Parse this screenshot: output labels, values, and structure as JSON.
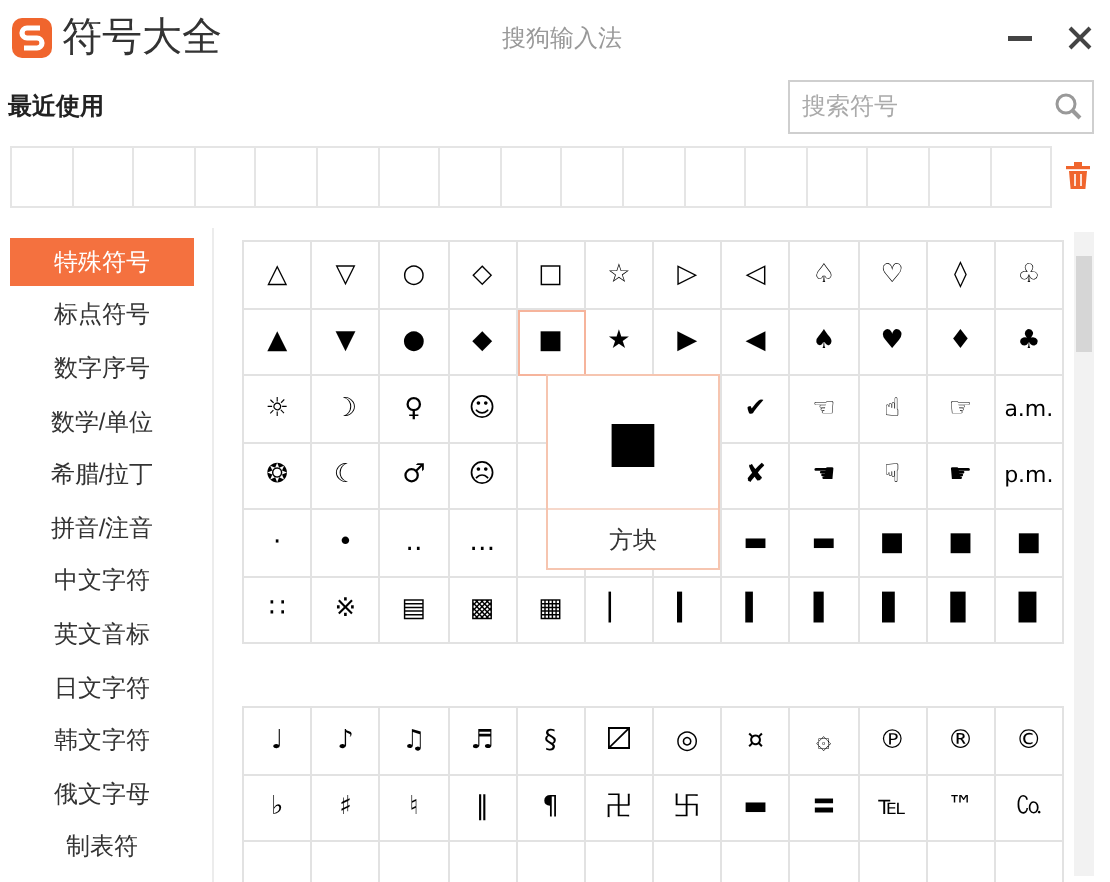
{
  "window": {
    "title": "符号大全",
    "app_name": "搜狗输入法"
  },
  "recent": {
    "label": "最近使用"
  },
  "search": {
    "placeholder": "搜索符号"
  },
  "categories": [
    {
      "label": "特殊符号",
      "selected": true
    },
    {
      "label": "标点符号",
      "selected": false
    },
    {
      "label": "数字序号",
      "selected": false
    },
    {
      "label": "数学/单位",
      "selected": false
    },
    {
      "label": "希腊/拉丁",
      "selected": false
    },
    {
      "label": "拼音/注音",
      "selected": false
    },
    {
      "label": "中文字符",
      "selected": false
    },
    {
      "label": "英文音标",
      "selected": false
    },
    {
      "label": "日文字符",
      "selected": false
    },
    {
      "label": "韩文字符",
      "selected": false
    },
    {
      "label": "俄文字母",
      "selected": false
    },
    {
      "label": "制表符",
      "selected": false
    }
  ],
  "grids": [
    {
      "rows": [
        [
          "△",
          "▽",
          "○",
          "◇",
          "□",
          "☆",
          "▷",
          "◁",
          "♤",
          "♡",
          "◊",
          "♧"
        ],
        [
          "▲",
          "▼",
          "●",
          "◆",
          {
            "symbol": "■",
            "selected": true
          },
          "★",
          "▶",
          "◀",
          "♠",
          "♥",
          "♦",
          "♣"
        ],
        [
          "☼",
          "☽",
          "♀",
          "☺",
          null,
          null,
          null,
          "✔",
          "☜",
          "☝",
          "☞",
          "a.m."
        ],
        [
          "❂",
          "☾",
          "♂",
          "☹",
          null,
          null,
          null,
          "✘",
          "☚",
          "☟",
          "☛",
          "p.m."
        ],
        [
          "·",
          "•",
          "‥",
          "…",
          null,
          null,
          null,
          "▬",
          "▬",
          "■",
          "■",
          "■"
        ],
        [
          "∷",
          "※",
          "▤",
          "▩",
          "▦",
          "▏",
          "▎",
          "▍",
          "▌",
          "▋",
          "▊",
          "▉"
        ]
      ]
    },
    {
      "rows": [
        [
          "♩",
          "♪",
          "♫",
          "♬",
          "§",
          "〼",
          "◎",
          "¤",
          "۞",
          "℗",
          "®",
          "©"
        ],
        [
          "♭",
          "♯",
          "♮",
          "‖",
          "¶",
          "卍",
          "卐",
          "▬",
          "〓",
          "℡",
          "™",
          "㏇"
        ]
      ]
    }
  ],
  "popup": {
    "symbol": "■",
    "label": "方块"
  }
}
